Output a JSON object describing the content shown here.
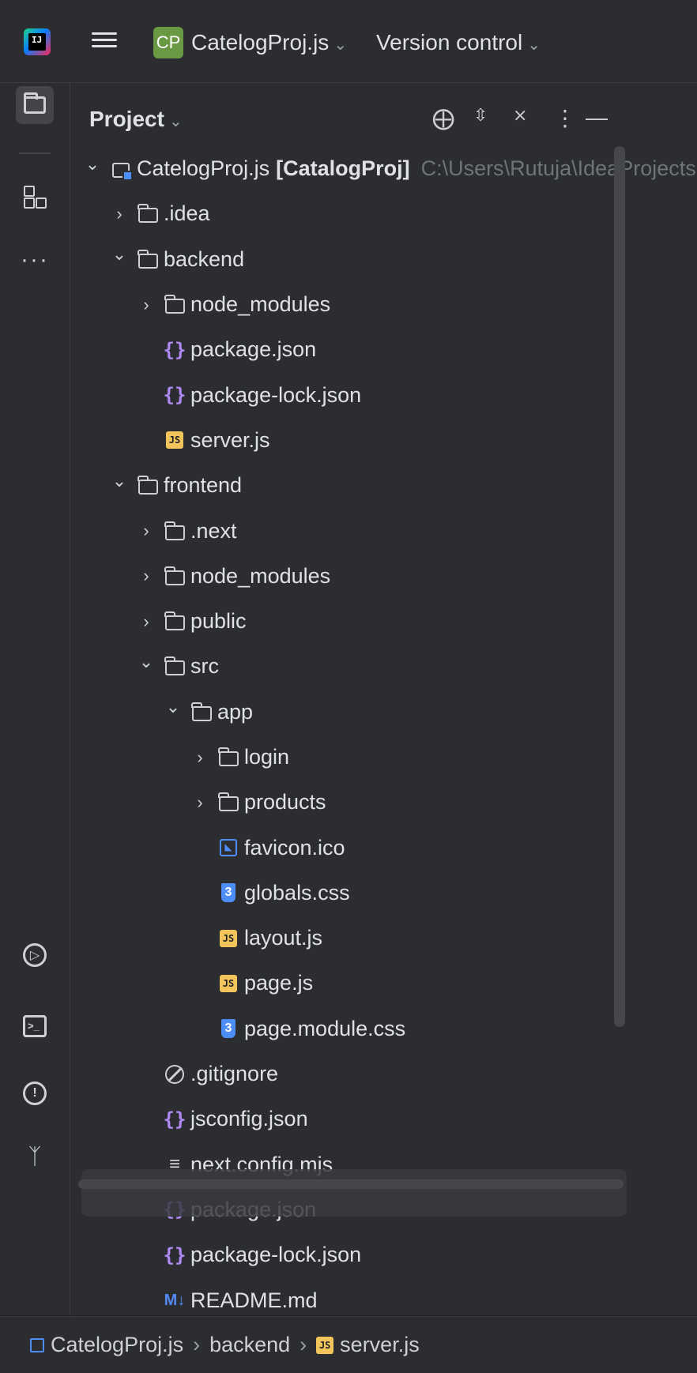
{
  "topbar": {
    "project_badge": "CP",
    "project_name": "CatelogProj.js",
    "version_control": "Version control"
  },
  "panel": {
    "title": "Project"
  },
  "tree": [
    {
      "depth": 0,
      "arrow": "expanded",
      "icon": "module",
      "name": "CatelogProj.js",
      "suffix": "[CatalogProj]",
      "path": "C:\\Users\\Rutuja\\IdeaProjects"
    },
    {
      "depth": 1,
      "arrow": "collapsed",
      "icon": "folder",
      "name": ".idea"
    },
    {
      "depth": 1,
      "arrow": "expanded",
      "icon": "folder",
      "name": "backend"
    },
    {
      "depth": 2,
      "arrow": "collapsed",
      "icon": "folder",
      "name": "node_modules"
    },
    {
      "depth": 2,
      "arrow": "none",
      "icon": "json",
      "name": "package.json"
    },
    {
      "depth": 2,
      "arrow": "none",
      "icon": "json",
      "name": "package-lock.json"
    },
    {
      "depth": 2,
      "arrow": "none",
      "icon": "js",
      "name": "server.js"
    },
    {
      "depth": 1,
      "arrow": "expanded",
      "icon": "folder",
      "name": "frontend"
    },
    {
      "depth": 2,
      "arrow": "collapsed",
      "icon": "folder",
      "name": ".next"
    },
    {
      "depth": 2,
      "arrow": "collapsed",
      "icon": "folder",
      "name": "node_modules"
    },
    {
      "depth": 2,
      "arrow": "collapsed",
      "icon": "folder",
      "name": "public"
    },
    {
      "depth": 2,
      "arrow": "expanded",
      "icon": "folder",
      "name": "src"
    },
    {
      "depth": 3,
      "arrow": "expanded",
      "icon": "folder",
      "name": "app"
    },
    {
      "depth": 4,
      "arrow": "collapsed",
      "icon": "folder",
      "name": "login"
    },
    {
      "depth": 4,
      "arrow": "collapsed",
      "icon": "folder",
      "name": "products"
    },
    {
      "depth": 4,
      "arrow": "none",
      "icon": "image",
      "name": "favicon.ico"
    },
    {
      "depth": 4,
      "arrow": "none",
      "icon": "css",
      "name": "globals.css"
    },
    {
      "depth": 4,
      "arrow": "none",
      "icon": "js",
      "name": "layout.js"
    },
    {
      "depth": 4,
      "arrow": "none",
      "icon": "js",
      "name": "page.js"
    },
    {
      "depth": 4,
      "arrow": "none",
      "icon": "css",
      "name": "page.module.css"
    },
    {
      "depth": 2,
      "arrow": "none",
      "icon": "ignore",
      "name": ".gitignore"
    },
    {
      "depth": 2,
      "arrow": "none",
      "icon": "json",
      "name": "jsconfig.json"
    },
    {
      "depth": 2,
      "arrow": "none",
      "icon": "text",
      "name": "next.config.mjs"
    },
    {
      "depth": 2,
      "arrow": "none",
      "icon": "json",
      "name": "package.json"
    },
    {
      "depth": 2,
      "arrow": "none",
      "icon": "json",
      "name": "package-lock.json"
    },
    {
      "depth": 2,
      "arrow": "none",
      "icon": "md",
      "name": "README.md"
    }
  ],
  "breadcrumb": {
    "project": "CatelogProj.js",
    "folder": "backend",
    "file": "server.js"
  },
  "colors": {
    "background": "#2b2d30",
    "accent_blue": "#4d8df7",
    "js_yellow": "#f2c55c",
    "json_purple": "#b189f5",
    "project_badge_green": "#6a9944"
  }
}
